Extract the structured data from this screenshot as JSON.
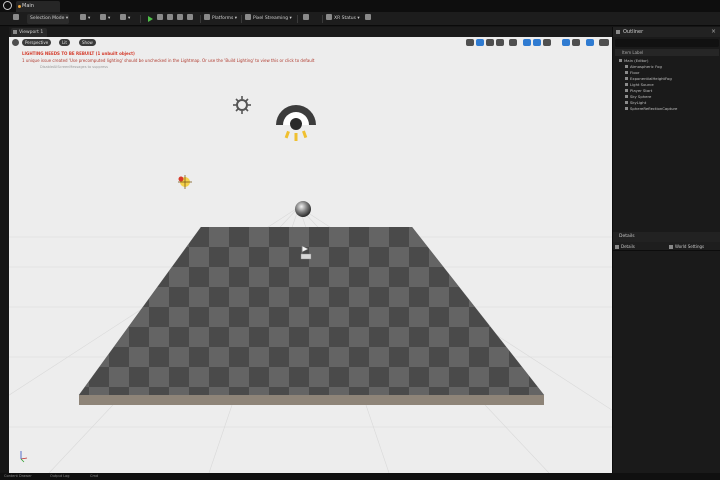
{
  "title_bar": {
    "level_tab": "Main"
  },
  "toolbar": {
    "mode": "Selection Mode",
    "platforms": "Platforms",
    "pixel_streaming": "Pixel Streaming",
    "xr_status": "XR Status"
  },
  "viewport": {
    "tab_label": "Viewport 1",
    "perspective": "Perspective",
    "lit": "Lit",
    "show": "Show",
    "warning_lighting": "LIGHTING NEEDS TO BE REBUILT (1 unbuilt object)",
    "warning_reflection": "1 unique issue created 'Use precomputed lighting' should be unchecked in the Lightmap. Or use the 'Build Lighting' to view this or click to default",
    "warning_small": "DisableAllScreenMessages to suppress"
  },
  "outliner": {
    "title": "Outliner",
    "column_header": "Item Label",
    "items": [
      {
        "label": "Main (Editor)",
        "indent": 0
      },
      {
        "label": "Atmospheric Fog",
        "indent": 1
      },
      {
        "label": "Floor",
        "indent": 1
      },
      {
        "label": "ExponentialHeightFog",
        "indent": 1
      },
      {
        "label": "Light Source",
        "indent": 1
      },
      {
        "label": "Player Start",
        "indent": 1
      },
      {
        "label": "Sky Sphere",
        "indent": 1
      },
      {
        "label": "SkyLight",
        "indent": 1
      },
      {
        "label": "SphereReflectionCapture",
        "indent": 1
      }
    ]
  },
  "details": {
    "title": "Details",
    "tab": "Details",
    "world_settings": "World Settings"
  },
  "status_bar": {
    "items": [
      "Content Drawer",
      "Output Log",
      "Cmd"
    ]
  },
  "colors": {
    "accent": "#2f7bd1",
    "warning_red": "#d43a2a",
    "play_green": "#4fc04a",
    "floor_dark": "#4a4a4a",
    "floor_light": "#646464"
  },
  "icons": [
    "unreal-logo-icon",
    "save-icon",
    "play-icon",
    "directional-light-icon",
    "sky-light-icon",
    "sun-sprite-icon",
    "player-start-icon",
    "reflection-sphere-icon"
  ]
}
